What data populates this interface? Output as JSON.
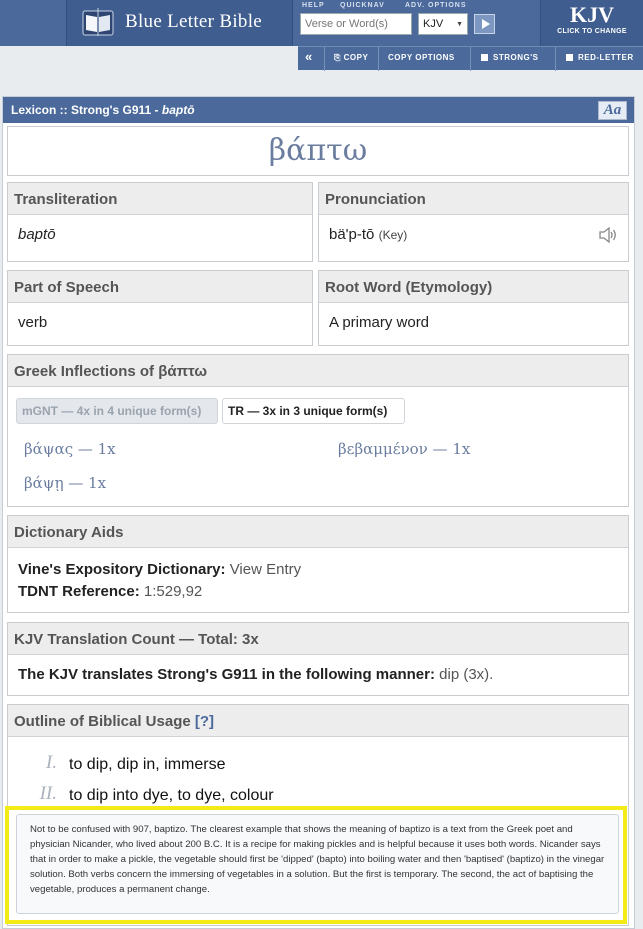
{
  "header": {
    "site_title": "Blue Letter Bible",
    "help_label": "HELP",
    "quicknav_label": "QUICKNAV",
    "adv_options_label": "ADV. OPTIONS",
    "search_placeholder": "Verse or Word(s)",
    "version_selected": "KJV",
    "version_badge": "KJV",
    "version_badge_sub": "CLICK TO CHANGE"
  },
  "toolbar": {
    "copy_label": "COPY",
    "copy_options_label": "COPY OPTIONS",
    "strongs_label": "STRONG'S",
    "red_letter_label": "RED-LETTER"
  },
  "panel": {
    "title_prefix": "Lexicon :: Strong's G911 - ",
    "title_word": "baptō",
    "aa_label": "Aa",
    "greek_word": "βάπτω"
  },
  "transliteration": {
    "heading": "Transliteration",
    "value": "baptō"
  },
  "pronunciation": {
    "heading": "Pronunciation",
    "value": "bä'p-tō",
    "key_label": "(Key)"
  },
  "part_of_speech": {
    "heading": "Part of Speech",
    "value": "verb"
  },
  "root_word": {
    "heading": "Root Word (Etymology)",
    "value": "A primary word"
  },
  "inflections": {
    "heading": "Greek Inflections of βάπτω",
    "tab_mgnt": "mGNT — 4x in 4 unique form(s)",
    "tab_tr": "TR — 3x in 3 unique form(s)",
    "forms": [
      "βάψας — 1x",
      "βεβαμμένον — 1x",
      "βάψῃ — 1x"
    ]
  },
  "dictionary": {
    "heading": "Dictionary Aids",
    "vines_label": "Vine's Expository Dictionary:",
    "vines_link": "View Entry",
    "tdnt_label": "TDNT Reference:",
    "tdnt_value": "1:529,92"
  },
  "translation": {
    "heading": "KJV Translation Count — Total: 3x",
    "sentence": "The KJV translates Strong's G911 in the following manner:",
    "value": "dip (3x)."
  },
  "outline": {
    "heading": "Outline of Biblical Usage",
    "help_link": "[?]",
    "items": [
      {
        "numeral": "I.",
        "text": "to dip, dip in, immerse"
      },
      {
        "numeral": "II.",
        "text": "to dip into dye, to dye, colour"
      }
    ],
    "note": "Not to be confused with 907, baptizo. The clearest example that shows the meaning of baptizo is a text from the Greek poet and physician Nicander, who lived about 200 B.C. It is a recipe for making pickles and is helpful because it uses both words. Nicander says that in order to make a pickle, the vegetable should first be 'dipped' (bapto) into boiling water and then 'baptised' (baptizo) in the vinegar solution. Both verbs concern the immersing of vegetables in a solution. But the first is temporary. The second, the act of baptising the vegetable, produces a permanent change."
  }
}
